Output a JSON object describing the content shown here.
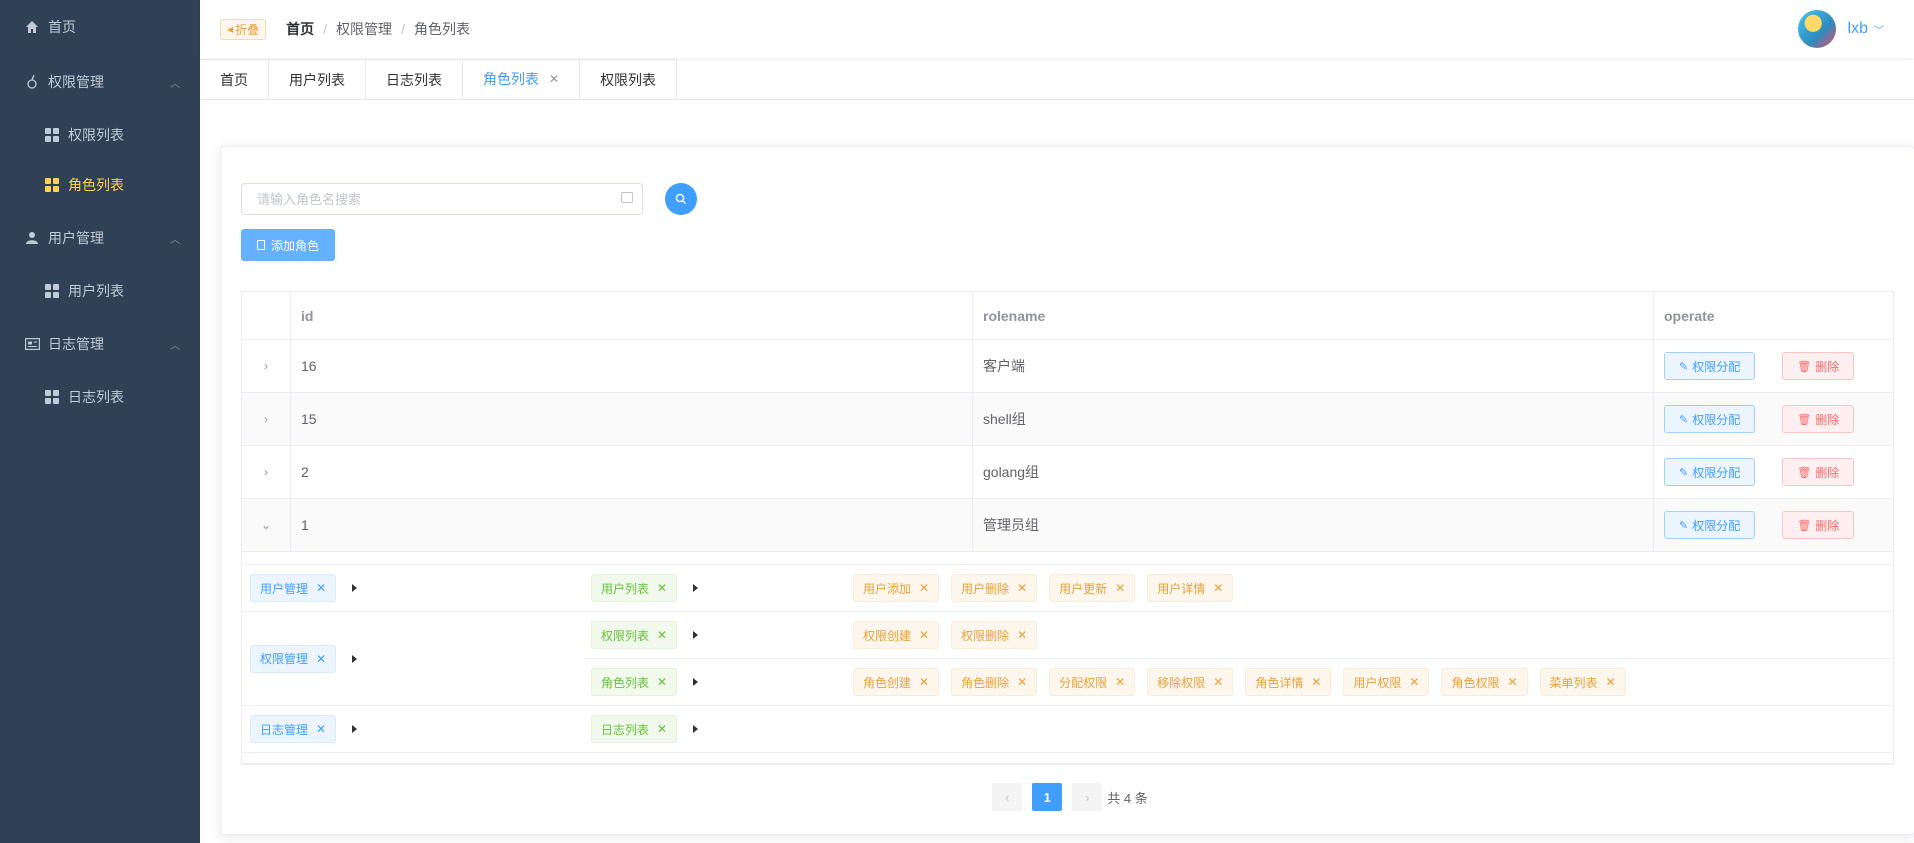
{
  "sidebar": {
    "home": "首页",
    "groups": [
      {
        "title": "权限管理",
        "items": [
          "权限列表",
          "角色列表"
        ]
      },
      {
        "title": "用户管理",
        "items": [
          "用户列表"
        ]
      },
      {
        "title": "日志管理",
        "items": [
          "日志列表"
        ]
      }
    ],
    "active_item": "角色列表",
    "bg_color": "#304156",
    "active_color": "#ffd04b"
  },
  "header": {
    "collapse_label": "折叠",
    "breadcrumb": [
      "首页",
      "权限管理",
      "角色列表"
    ],
    "username": "lxb"
  },
  "tabs": [
    {
      "label": "首页"
    },
    {
      "label": "用户列表"
    },
    {
      "label": "日志列表"
    },
    {
      "label": "角色列表",
      "active": true,
      "closable": true
    },
    {
      "label": "权限列表"
    }
  ],
  "toolbar": {
    "search_placeholder": "请输入角色名搜索",
    "add_label": "添加角色"
  },
  "table": {
    "columns": [
      "id",
      "rolename",
      "operate"
    ],
    "rows": [
      {
        "id": "16",
        "rolename": "客户端"
      },
      {
        "id": "15",
        "rolename": "shell组"
      },
      {
        "id": "2",
        "rolename": "golang组"
      },
      {
        "id": "1",
        "rolename": "管理员组",
        "expanded": true
      }
    ],
    "edit_label": "权限分配",
    "delete_label": "删除"
  },
  "expanded": {
    "groups": [
      {
        "name": "用户管理",
        "children": [
          {
            "name": "用户列表",
            "perms": [
              "用户添加",
              "用户删除",
              "用户更新",
              "用户详情"
            ]
          }
        ]
      },
      {
        "name": "权限管理",
        "children": [
          {
            "name": "权限列表",
            "perms": [
              "权限创建",
              "权限删除"
            ]
          },
          {
            "name": "角色列表",
            "perms": [
              "角色创建",
              "角色删除",
              "分配权限",
              "移除权限",
              "角色详情",
              "用户权限",
              "角色权限",
              "菜单列表"
            ]
          }
        ]
      },
      {
        "name": "日志管理",
        "children": [
          {
            "name": "日志列表",
            "perms": []
          }
        ]
      }
    ]
  },
  "pagination": {
    "current": "1",
    "total_text": "共 4 条"
  },
  "colors": {
    "primary": "#409eff",
    "danger": "#f56c6c",
    "success": "#67c23a",
    "warning": "#e6a23c"
  }
}
